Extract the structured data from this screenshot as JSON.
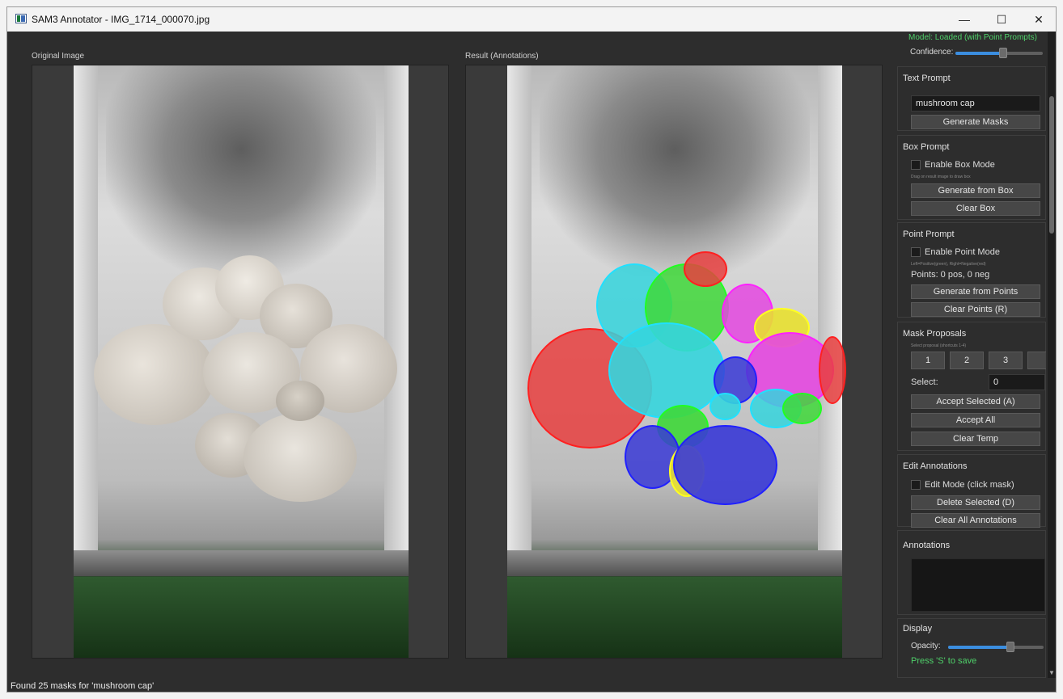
{
  "window": {
    "title": "SAM3 Annotator - IMG_1714_000070.jpg",
    "controls": {
      "minimize": "—",
      "maximize": "☐",
      "close": "✕"
    }
  },
  "views": {
    "original_label": "Original Image",
    "result_label": "Result (Annotations)"
  },
  "sidebar": {
    "model_status": "Model: Loaded (with Point Prompts)",
    "confidence_label": "Confidence:",
    "confidence_value": 0.55,
    "text_prompt": {
      "title": "Text Prompt",
      "input_value": "mushroom cap",
      "generate_button": "Generate Masks"
    },
    "box_prompt": {
      "title": "Box Prompt",
      "enable_label": "Enable Box Mode",
      "hint": "Drag on result image to draw box",
      "generate_button": "Generate from Box",
      "clear_button": "Clear Box"
    },
    "point_prompt": {
      "title": "Point Prompt",
      "enable_label": "Enable Point Mode",
      "hint": "Left=Positive(green), Right=Negative(red)",
      "points_status": "Points: 0 pos, 0 neg",
      "generate_button": "Generate from Points",
      "clear_button": "Clear Points (R)"
    },
    "mask_proposals": {
      "title": "Mask Proposals",
      "hint": "Select proposal (shortcuts 1-4)",
      "buttons": [
        "1",
        "2",
        "3"
      ],
      "select_label": "Select:",
      "select_value": "0",
      "accept_selected_button": "Accept Selected (A)",
      "accept_all_button": "Accept All",
      "clear_temp_button": "Clear Temp"
    },
    "edit_annotations": {
      "title": "Edit Annotations",
      "edit_mode_label": "Edit Mode (click mask)",
      "delete_button": "Delete Selected (D)",
      "clear_all_button": "Clear All Annotations"
    },
    "annotations": {
      "title": "Annotations"
    },
    "display": {
      "title": "Display",
      "opacity_label": "Opacity:",
      "opacity_value": 0.65,
      "save_hint": "Press 'S' to save"
    }
  },
  "status_bar": {
    "text": "Found 25 masks for 'mushroom cap'"
  },
  "colors": {
    "accent": "#3b8ee0",
    "status_green": "#4fd16a",
    "mask_red": "#e8403f",
    "mask_cyan": "#35d5dd",
    "mask_green": "#3fd83a",
    "mask_magenta": "#e448e0",
    "mask_yellow": "#e8e030",
    "mask_blue": "#3a3ad6"
  }
}
